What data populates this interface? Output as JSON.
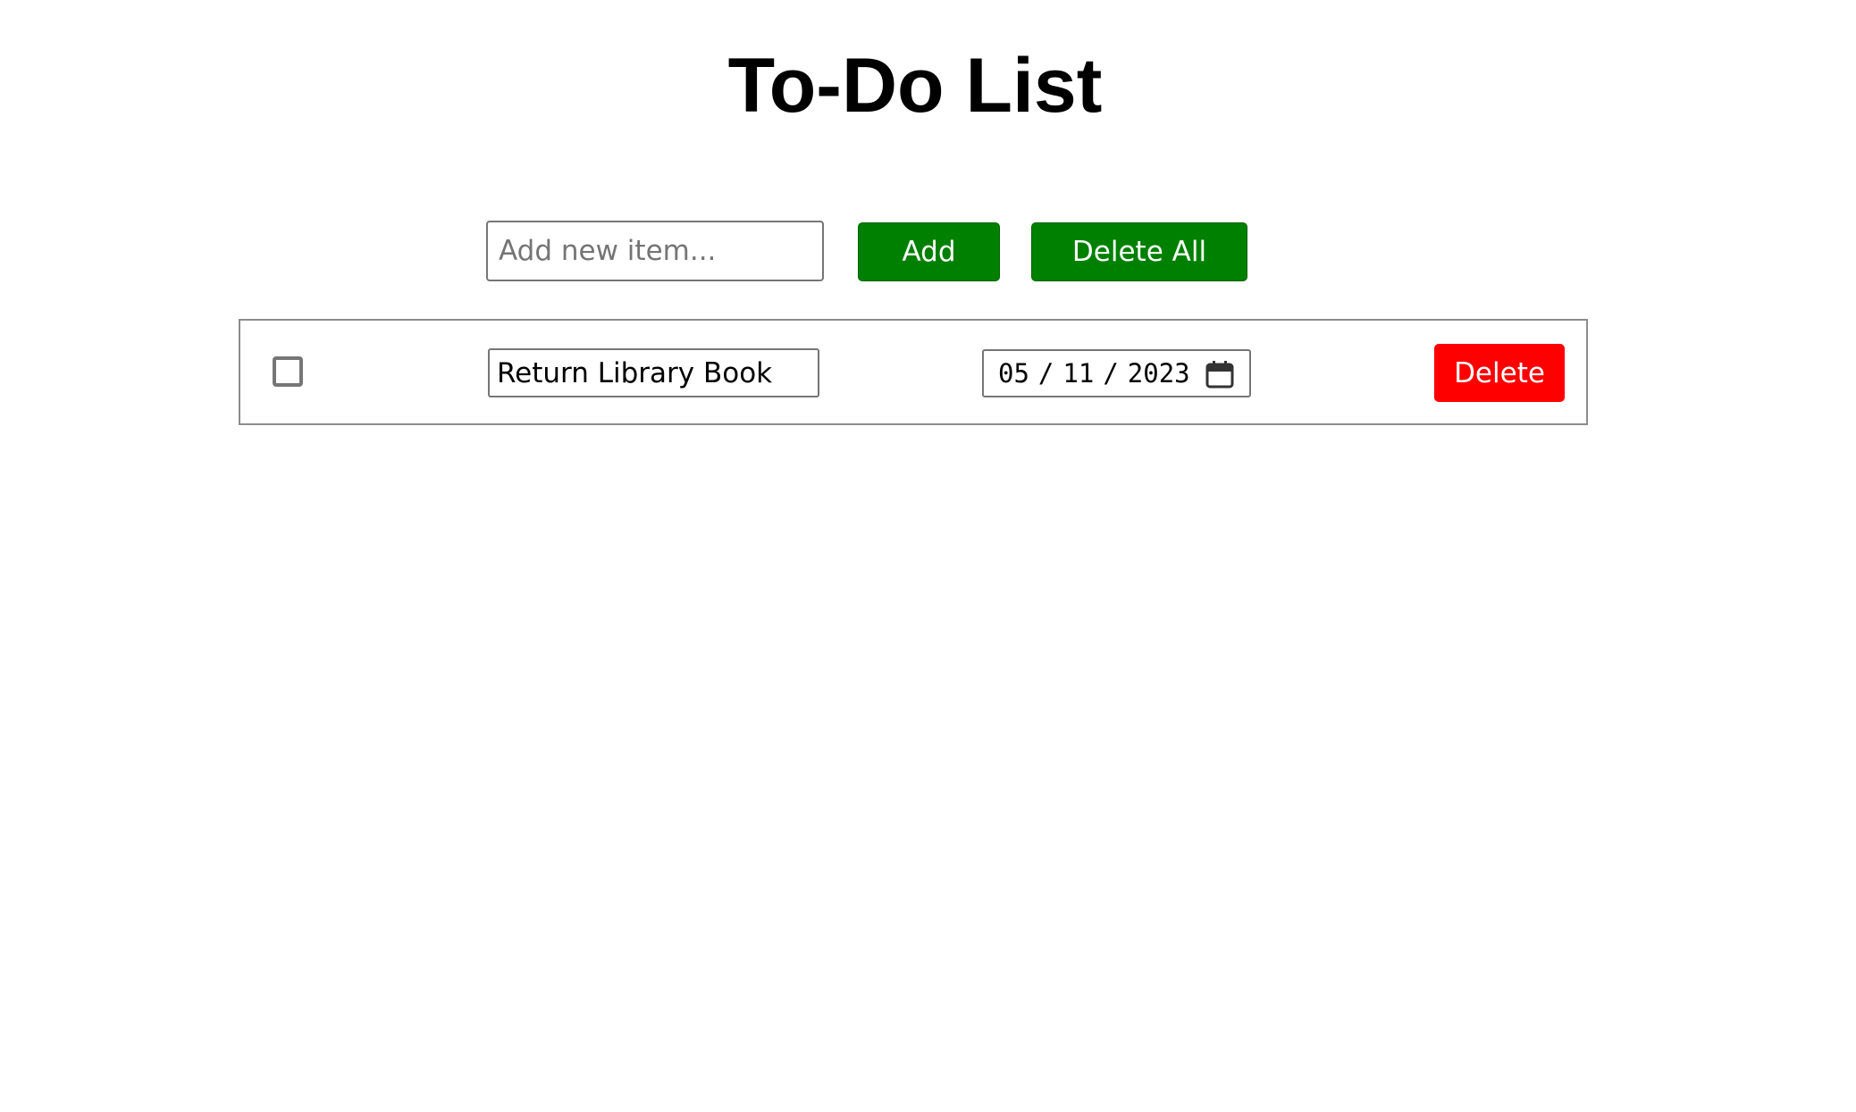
{
  "page": {
    "title": "To-Do List"
  },
  "toolbar": {
    "input_placeholder": "Add new item...",
    "input_value": "",
    "add_label": "Add",
    "delete_all_label": "Delete All"
  },
  "colors": {
    "primary_button": "#008000",
    "danger_button": "#ff0000",
    "border": "#767676"
  },
  "items": [
    {
      "checked": false,
      "text": "Return Library Book",
      "date": {
        "month": "05",
        "day": "11",
        "year": "2023",
        "separator": "/"
      },
      "delete_label": "Delete",
      "calendar_icon": "calendar-icon"
    }
  ]
}
